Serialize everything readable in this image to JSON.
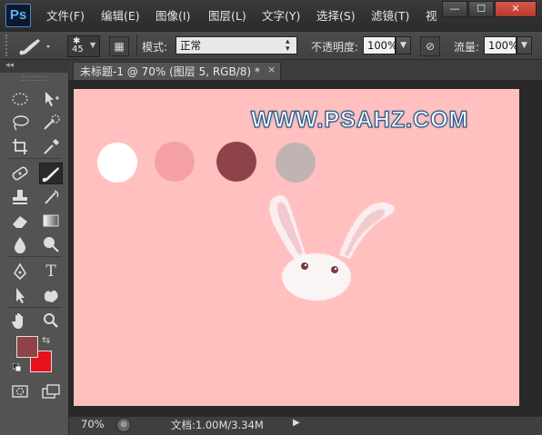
{
  "app": {
    "logo": "Ps"
  },
  "menu": [
    {
      "label": "文件(F)",
      "id": "file"
    },
    {
      "label": "编辑(E)",
      "id": "edit"
    },
    {
      "label": "图像(I)",
      "id": "image"
    },
    {
      "label": "图层(L)",
      "id": "layer"
    },
    {
      "label": "文字(Y)",
      "id": "type"
    },
    {
      "label": "选择(S)",
      "id": "select"
    },
    {
      "label": "滤镜(T)",
      "id": "filter"
    },
    {
      "label": "视",
      "id": "view"
    }
  ],
  "window_controls": {
    "minimize": "—",
    "maximize": "☐",
    "close": "✕"
  },
  "options": {
    "brush_size": "45",
    "mode_label": "模式:",
    "mode_value": "正常",
    "opacity_label": "不透明度:",
    "opacity_value": "100%",
    "flow_label": "流量:",
    "flow_value": "100%"
  },
  "document_tab": {
    "title": "未标题-1 @ 70% (图层 5, RGB/8) *",
    "close": "×"
  },
  "canvas": {
    "background": "#ffc0bf",
    "watermark": "WWW.PSAHZ.COM",
    "swatches": [
      "#ffffff",
      "#f5a0a2",
      "#8e4349",
      "#bfb3b3"
    ]
  },
  "colors": {
    "foreground": "#8e4349",
    "background": "#e8101a"
  },
  "status": {
    "zoom": "70%",
    "doc_info": "文档:1.00M/3.34M"
  },
  "icons": [
    "brush-icon",
    "marquee-icon",
    "move-icon",
    "lasso-icon",
    "quick-select-icon",
    "crop-icon",
    "eyedropper-icon",
    "healing-icon",
    "brush-tool-icon",
    "stamp-icon",
    "history-brush-icon",
    "eraser-icon",
    "gradient-icon",
    "blur-icon",
    "dodge-icon",
    "pen-icon",
    "text-icon",
    "path-select-icon",
    "shape-icon",
    "hand-icon",
    "zoom-icon",
    "quick-mask-icon",
    "screen-mode-icon"
  ]
}
